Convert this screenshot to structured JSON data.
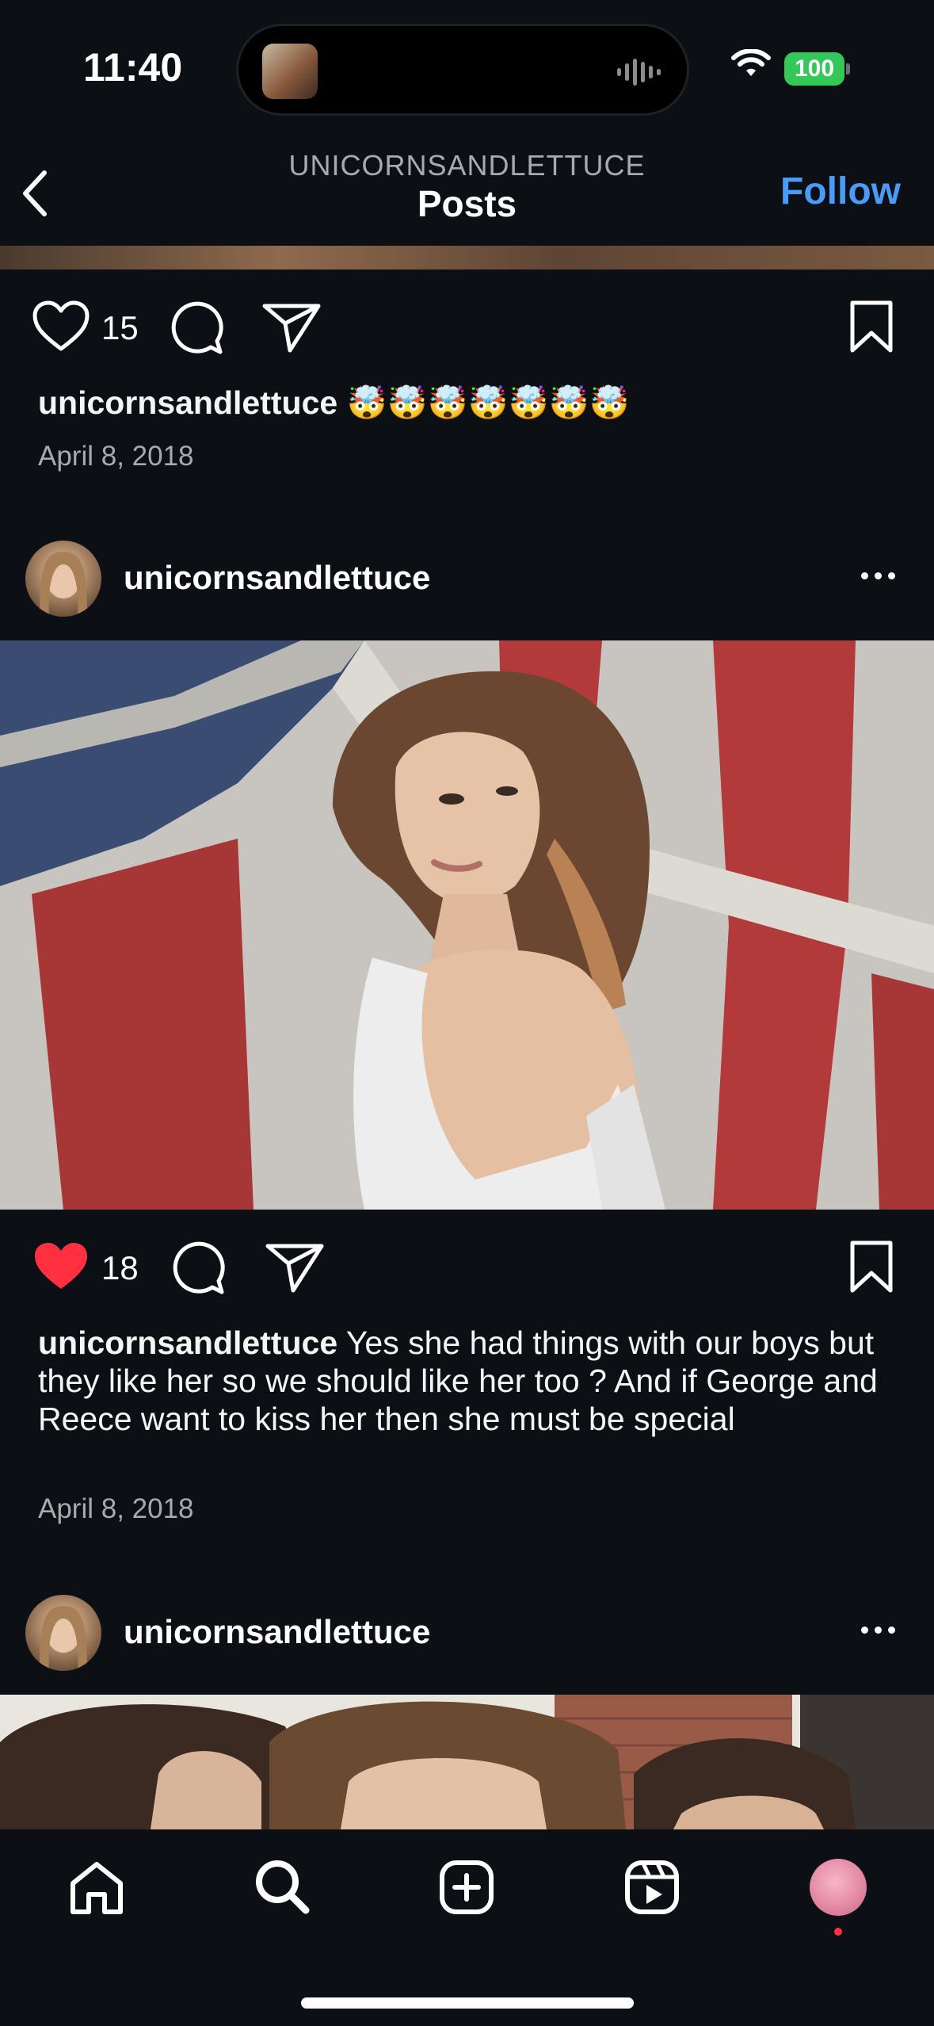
{
  "status_bar": {
    "time": "11:40",
    "battery": "100"
  },
  "header": {
    "username": "UNICORNSANDLETTUCE",
    "title": "Posts",
    "follow_label": "Follow"
  },
  "posts": [
    {
      "likes": "15",
      "liked": false,
      "caption_user": "unicornsandlettuce",
      "caption_text": " 🤯🤯🤯🤯🤯🤯🤯",
      "date": "April 8, 2018"
    },
    {
      "username": "unicornsandlettuce",
      "likes": "18",
      "liked": true,
      "caption_user": "unicornsandlettuce",
      "caption_text": " Yes she had things with our boys but they like her so we should like her too ? And if George and Reece want to kiss her then she must be special",
      "date": "April 8, 2018"
    },
    {
      "username": "unicornsandlettuce"
    }
  ],
  "colors": {
    "background": "#0c1014",
    "follow": "#4a9bf5",
    "liked_heart": "#ff3040",
    "battery": "#34c759"
  },
  "icons": {
    "tab_bar": [
      "home-icon",
      "search-icon",
      "create-icon",
      "reels-icon",
      "profile-avatar"
    ],
    "post_actions": [
      "heart-icon",
      "comment-icon",
      "share-icon",
      "bookmark-icon"
    ]
  }
}
